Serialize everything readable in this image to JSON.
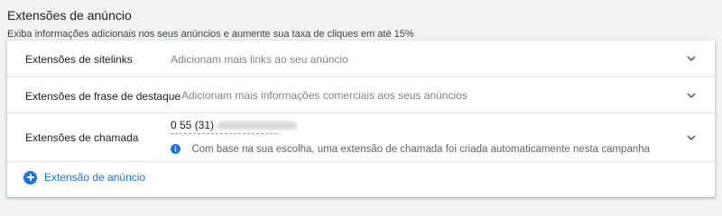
{
  "section": {
    "title": "Extensões de anúncio",
    "subtitle": "Exiba informações adicionais nos seus anúncios e aumente sua taxa de cliques em até 15%"
  },
  "extensions": [
    {
      "label": "Extensões de sitelinks",
      "description": "Adicionam mais links ao seu anúncio",
      "icon": "chevron-down-icon"
    },
    {
      "label": "Extensões de frase de destaque",
      "description": "Adicionam mais informações comerciais aos seus anúncios",
      "icon": "chevron-down-icon"
    },
    {
      "label": "Extensões de chamada",
      "phone_prefix": "0 55 (31)",
      "info_text": "Com base na sua escolha, uma extensão de chamada foi criada automaticamente nesta campanha",
      "icon": "chevron-down-icon"
    }
  ],
  "add_button": {
    "label": "Extensão de anúncio",
    "icon": "add-circle-icon"
  },
  "colors": {
    "accent": "#1a73e8",
    "background": "#f1f3f4",
    "card": "#ffffff",
    "muted_text": "#80868b",
    "info_icon": "#1a73e8"
  }
}
